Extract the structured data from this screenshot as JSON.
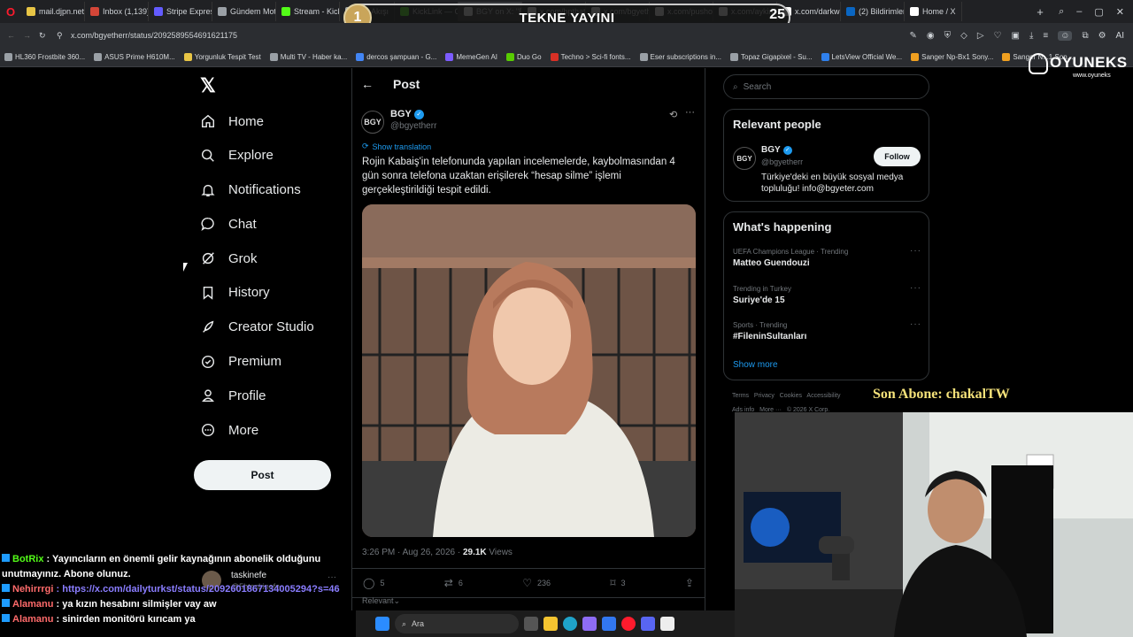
{
  "browser": {
    "tabs": [
      {
        "label": "mail.djpn.net",
        "color": "#e8c545"
      },
      {
        "label": "Inbox (1,139)",
        "color": "#d44638"
      },
      {
        "label": "Stripe Express",
        "color": "#635bff"
      },
      {
        "label": "Gündem Motor",
        "color": "#9aa0a6"
      },
      {
        "label": "Stream - Kick",
        "color": "#53fc18"
      },
      {
        "label": "ner Akışı",
        "color": "#9aa0a6"
      },
      {
        "label": "KickLink — Cl",
        "color": "#53fc18"
      },
      {
        "label": "BGY on X: \"Rojin Kaba",
        "color": "#ffffff"
      },
      {
        "label": "x.com/bpthat",
        "color": "#ffffff"
      },
      {
        "label": "x.com/bgyeth",
        "color": "#ffffff"
      },
      {
        "label": "x.com/pushok",
        "color": "#ffffff"
      },
      {
        "label": "x.com/aykiri/s",
        "color": "#ffffff"
      },
      {
        "label": "x.com/darkwe",
        "color": "#ffffff"
      },
      {
        "label": "(2) Bildirimler",
        "color": "#0a66c2"
      },
      {
        "label": "Home / X",
        "color": "#ffffff"
      }
    ],
    "url": "x.com/bgyetherr/status/2092589554691621175",
    "bookmarks": [
      {
        "label": "HL360 Frostbite 360...",
        "color": "#9aa0a6"
      },
      {
        "label": "ASUS Prime H610M...",
        "color": "#9aa0a6"
      },
      {
        "label": "Yorgunluk Tespit Test",
        "color": "#e8c545"
      },
      {
        "label": "Multi TV - Haber ka...",
        "color": "#9aa0a6"
      },
      {
        "label": "dercos şampuan - G...",
        "color": "#4285f4"
      },
      {
        "label": "MemeGen AI",
        "color": "#7c5cff"
      },
      {
        "label": "Duo Go",
        "color": "#58cc02"
      },
      {
        "label": "Techno > Sci-fi fonts...",
        "color": "#d93025"
      },
      {
        "label": "Eser subscriptions in...",
        "color": "#9aa0a6"
      },
      {
        "label": "Topaz Gigapixel - Su...",
        "color": "#9aa0a6"
      },
      {
        "label": "LetsView Official We...",
        "color": "#2f80ed"
      },
      {
        "label": "Sanger Np-Bx1 Sony...",
        "color": "#f0a020"
      },
      {
        "label": "Sanger N...1 Son...",
        "color": "#f0a020"
      }
    ]
  },
  "overlay": {
    "badge_left": "1",
    "banner": "TEKNE YAYINI",
    "badge_right": "25",
    "brand": "OYUNEKS",
    "brand_sub": "www.oyuneks",
    "subscriber": "Son Abone: chakalTW"
  },
  "nav": {
    "items": [
      {
        "label": "Home",
        "icon": "home-icon"
      },
      {
        "label": "Explore",
        "icon": "search-icon"
      },
      {
        "label": "Notifications",
        "icon": "bell-icon"
      },
      {
        "label": "Chat",
        "icon": "chat-icon"
      },
      {
        "label": "Grok",
        "icon": "grok-icon"
      },
      {
        "label": "History",
        "icon": "bookmark-icon"
      },
      {
        "label": "Creator Studio",
        "icon": "rocket-icon"
      },
      {
        "label": "Premium",
        "icon": "verified-icon"
      },
      {
        "label": "Profile",
        "icon": "person-icon"
      },
      {
        "label": "More",
        "icon": "more-circle-icon"
      }
    ],
    "post_button": "Post"
  },
  "post": {
    "header": "Post",
    "author_name": "BGY",
    "author_handle": "@bgyetherr",
    "show_translation": "Show translation",
    "text": "Rojin Kabaiş'in telefonunda yapılan incelemelerde, kaybolmasından 4 gün sonra telefona uzaktan erişilerek “hesap silme” işlemi gerçekleştirildiği tespit edildi.",
    "time": "3:26 PM · Aug 26, 2026 · ",
    "views_count": "29.1K",
    "views_label": " Views",
    "replies": "5",
    "reposts": "6",
    "likes": "236",
    "bookmarks": "3",
    "sort": "Relevant"
  },
  "right": {
    "search_placeholder": "Search",
    "relevant_title": "Relevant people",
    "person_name": "BGY",
    "person_handle": "@bgyetherr",
    "follow": "Follow",
    "bio": "Türkiye'deki en büyük sosyal medya topluluğu! info@bgyeter.com",
    "happening_title": "What's happening",
    "trends": [
      {
        "meta": "UEFA Champions League · Trending",
        "title": "Matteo Guendouzi"
      },
      {
        "meta": "Trending in Turkey",
        "title": "Suriye'de 15"
      },
      {
        "meta": "Sports · Trending",
        "title": "#FileninSultanları"
      }
    ],
    "show_more": "Show more",
    "footer": "Terms   Privacy   Cookies   Accessibility",
    "footer2": "Ads info   More ···   © 2026 X Corp."
  },
  "chat": [
    {
      "user": "BotRix",
      "user_color": "#53fc18",
      "text": " : Yayıncıların en önemli gelir kaynağının abonelik olduğunu",
      "text_color": "#ffffff"
    },
    {
      "user": "",
      "user_color": "#ffffff",
      "text": "unutmayınız. Abone olunuz.",
      "text_color": "#ffffff"
    },
    {
      "user": "Nehirrrgi",
      "user_color": "#ff6b6b",
      "text": " : https://x.com/dailyturkst/status/2092601867134005294?s=46",
      "text_color": "#8a7dff"
    },
    {
      "user": "Alamanu",
      "user_color": "#ff6b6b",
      "text": " : ya kızın hesabını silmişler vay aw",
      "text_color": "#ffffff"
    },
    {
      "user": "Alamanu",
      "user_color": "#ff6b6b",
      "text": " : sinirden monitörü kırıcam ya",
      "text_color": "#ffffff"
    }
  ],
  "reply_preview": {
    "name": "taskinefe",
    "handle": "@5htaskinefe"
  },
  "taskbar": {
    "search": "Ara"
  }
}
